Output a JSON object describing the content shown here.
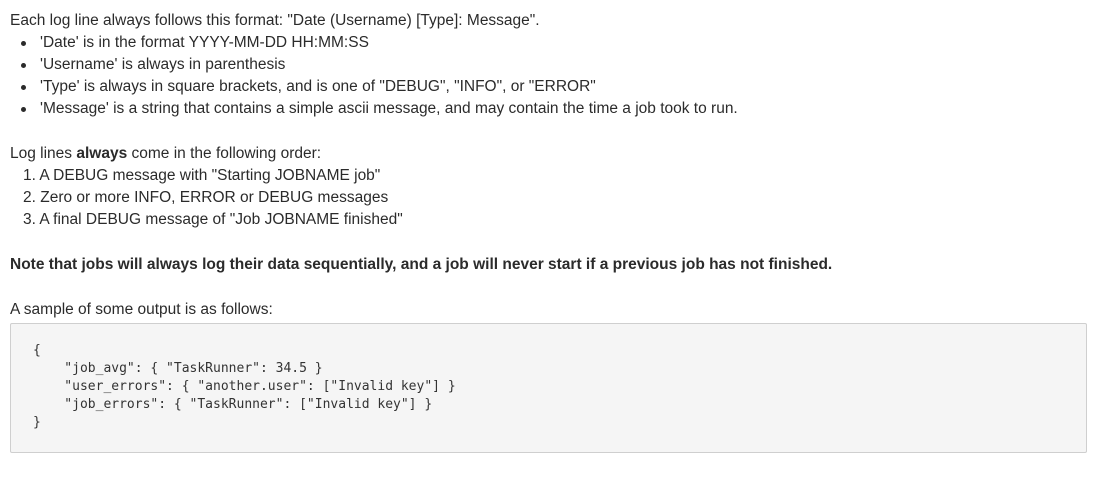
{
  "intro": {
    "text": "Each log line always follows this format: \"Date (Username) [Type]: Message\"."
  },
  "format_rules": [
    "'Date' is in the format YYYY-MM-DD HH:MM:SS",
    "'Username' is always in parenthesis",
    "'Type' is always in square brackets, and is one of  \"DEBUG\", \"INFO\", or \"ERROR\"",
    "'Message' is a string that contains a simple ascii message, and may contain the time a job took to run."
  ],
  "order": {
    "lead_before": "Log lines ",
    "lead_bold": "always",
    "lead_after": " come in the following order:",
    "items": [
      "1. A DEBUG message with \"Starting JOBNAME job\"",
      "2. Zero or more INFO, ERROR or DEBUG messages",
      "3. A final DEBUG message of \"Job JOBNAME finished\""
    ]
  },
  "note": {
    "text": "Note that jobs will always log their data sequentially, and a job will never start if a previous job has not finished."
  },
  "sample": {
    "lead": "A sample of some output is as follows:",
    "code_lines": [
      "{",
      "    \"job_avg\": { \"TaskRunner\": 34.5 }",
      "    \"user_errors\": { \"another.user\": [\"Invalid key\"] }",
      "    \"job_errors\": { \"TaskRunner\": [\"Invalid key\"] }",
      "}"
    ]
  }
}
